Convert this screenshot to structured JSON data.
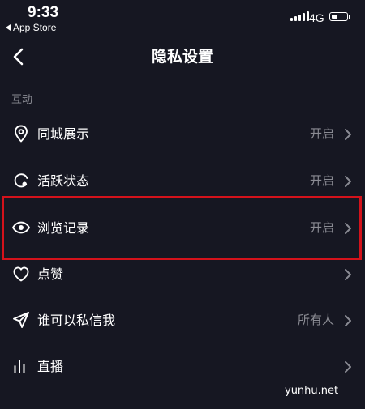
{
  "status_bar": {
    "time": "9:33",
    "back_app": "App Store",
    "network": "4G",
    "battery_level": 0.35
  },
  "nav": {
    "title": "隐私设置"
  },
  "section": {
    "label": "互动"
  },
  "rows": [
    {
      "icon": "location-pin-icon",
      "label": "同城展示",
      "value": "开启"
    },
    {
      "icon": "active-status-icon",
      "label": "活跃状态",
      "value": "开启"
    },
    {
      "icon": "eye-icon",
      "label": "浏览记录",
      "value": "开启",
      "highlighted": true
    },
    {
      "icon": "heart-icon",
      "label": "点赞",
      "value": ""
    },
    {
      "icon": "send-icon",
      "label": "谁可以私信我",
      "value": "所有人"
    },
    {
      "icon": "live-bars-icon",
      "label": "直播",
      "value": ""
    }
  ],
  "colors": {
    "background": "#161722",
    "secondary_text": "#8a8b93",
    "highlight_border": "#d4121b"
  },
  "watermark": "yunhu.net"
}
